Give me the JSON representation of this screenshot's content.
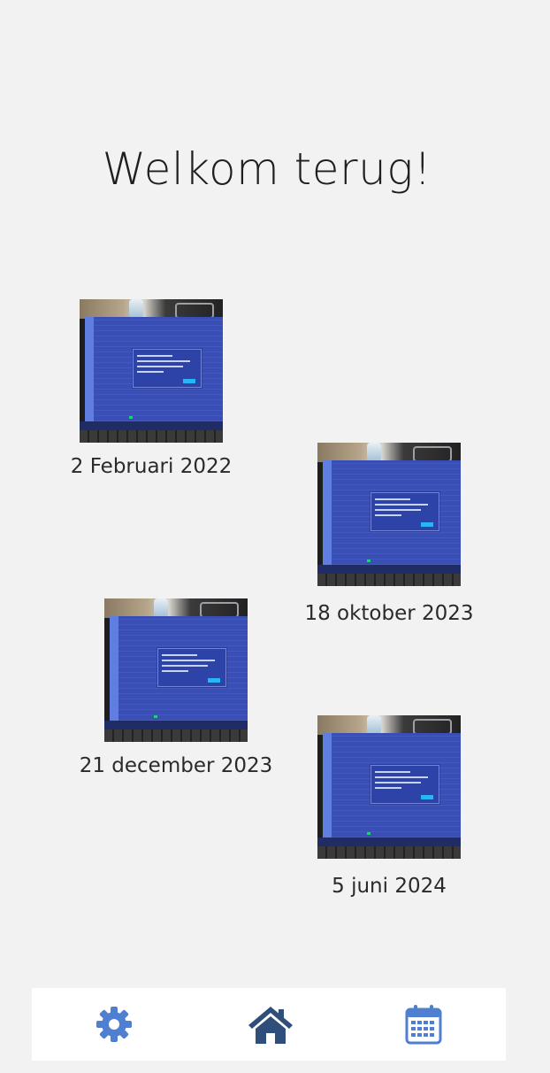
{
  "header": {
    "title": "Welkom terug!"
  },
  "entries": [
    {
      "date": "2 Februari 2022",
      "thumbnail": "laptop-screenshot-photo"
    },
    {
      "date": "18 oktober 2023",
      "thumbnail": "laptop-screenshot-photo"
    },
    {
      "date": "21 december 2023",
      "thumbnail": "laptop-screenshot-photo"
    },
    {
      "date": "5 juni 2024",
      "thumbnail": "laptop-screenshot-photo"
    }
  ],
  "bottom_nav": {
    "items": [
      {
        "icon": "gear-icon",
        "color": "#4f7fd1"
      },
      {
        "icon": "home-icon",
        "color": "#2f4f7a"
      },
      {
        "icon": "calendar-icon",
        "color": "#4f7fd1"
      }
    ]
  },
  "colors": {
    "background": "#f2f2f2",
    "nav_background": "#ffffff",
    "accent": "#4f7fd1",
    "home_active": "#2f4f7a",
    "text": "#2a2a2a"
  }
}
